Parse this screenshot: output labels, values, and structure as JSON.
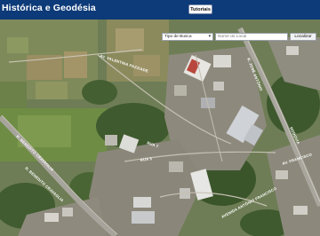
{
  "header": {
    "title": "Histórica e Geodésia",
    "tutorials_label": "Tutoriais"
  },
  "search": {
    "type_label": "Tipo de Busca",
    "place_placeholder": "Nome do Local",
    "locate_label": "Localizar"
  },
  "map": {
    "view": "satellite",
    "road_labels": {
      "r1": "AV. VALENTINA PAZZIADE",
      "r2": "R. BENEDITO CRAVAGLIA",
      "r3": "RUA 7",
      "r4": "R. BENEDITO CRAVAGLIA",
      "r5": "RUA 5",
      "r6": "AVENIDA ANTÔNIO FRANCISCO",
      "r7": "R. JOSÉ ANTÔNIO",
      "r8": "AV. FRANCISCO",
      "r9": "RODOVIA"
    }
  },
  "colors": {
    "header_bg": "#0d3a78",
    "header_text": "#ffffff"
  }
}
